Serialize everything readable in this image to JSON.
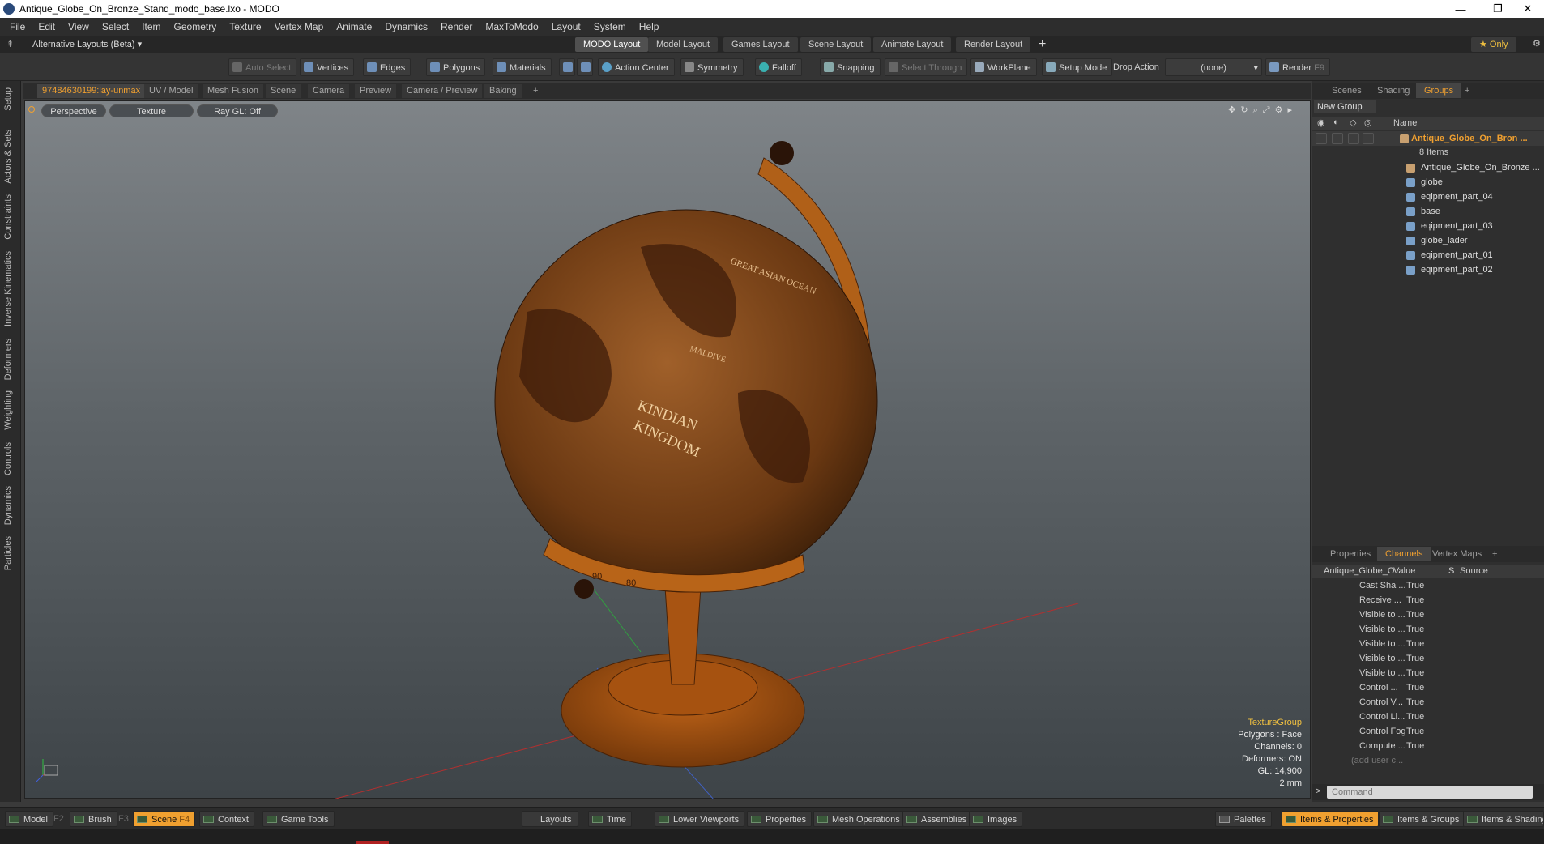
{
  "window": {
    "title": "Antique_Globe_On_Bronze_Stand_modo_base.lxo - MODO",
    "minimize": "—",
    "restore": "❐",
    "close": "✕"
  },
  "menu": [
    "File",
    "Edit",
    "View",
    "Select",
    "Item",
    "Geometry",
    "Texture",
    "Vertex Map",
    "Animate",
    "Dynamics",
    "Render",
    "MaxToModo",
    "Layout",
    "System",
    "Help"
  ],
  "layouts": {
    "current": "Alternative Layouts (Beta)",
    "tabs": [
      "MODO Layout",
      "Model Layout",
      "Games Layout",
      "Scene Layout",
      "Animate Layout",
      "Render Layout"
    ],
    "add": "+",
    "only": "★  Only"
  },
  "toolbar": {
    "auto_select": "Auto Select",
    "vertices": "Vertices",
    "edges": "Edges",
    "polygons": "Polygons",
    "materials": "Materials",
    "action_center": "Action Center",
    "symmetry": "Symmetry",
    "falloff": "Falloff",
    "snapping": "Snapping",
    "select_through": "Select Through",
    "workplane": "WorkPlane",
    "setup_mode": "Setup Mode",
    "drop_action": "Drop Action",
    "drop_value": "(none)",
    "render": "Render",
    "render_key": "F9"
  },
  "left_tabs": [
    "Setup",
    "Actors & Sets",
    "Constraints",
    "Inverse Kinematics",
    "Deformers",
    "Weighting",
    "Controls",
    "Dynamics",
    "Particles"
  ],
  "viewport_tabs": [
    "97484630199:lay-unmax",
    "UV / Model",
    "Mesh Fusion",
    "Scene",
    "Camera",
    "Preview",
    "Camera / Preview",
    "Baking",
    "+"
  ],
  "viewport": {
    "view": "Perspective",
    "shading": "Texture",
    "raygl": "Ray GL: Off",
    "globe_labels": [
      "GREAT ASIAN OCEAN",
      "KINDIAN",
      "KINGDOM",
      "MALDIVE"
    ],
    "stand_numbers": [
      "90",
      "80"
    ]
  },
  "vp_info": {
    "group": "TextureGroup",
    "polygons": "Polygons : Face",
    "channels": "Channels: 0",
    "deformers": "Deformers: ON",
    "gl": "GL: 14,900",
    "scale": "2 mm"
  },
  "scene_tabs": [
    "Scenes",
    "Shading",
    "Groups",
    "+"
  ],
  "groups": {
    "new_group": "New Group",
    "name_header": "Name",
    "root": "Antique_Globe_On_Bron ...",
    "count": "8 Items",
    "items": [
      "Antique_Globe_On_Bronze ...",
      "globe",
      "eqipment_part_04",
      "base",
      "eqipment_part_03",
      "globe_lader",
      "eqipment_part_01",
      "eqipment_part_02"
    ]
  },
  "prop_tabs": [
    "Properties",
    "Channels",
    "Vertex Maps",
    "+"
  ],
  "channels": {
    "headers": [
      "Antique_Globe_O ...",
      "Value",
      "S",
      "Source"
    ],
    "rows": [
      [
        "Cast Sha ...",
        "True"
      ],
      [
        "Receive ...",
        "True"
      ],
      [
        "Visible to ...",
        "True"
      ],
      [
        "Visible to ...",
        "True"
      ],
      [
        "Visible to ...",
        "True"
      ],
      [
        "Visible to ...",
        "True"
      ],
      [
        "Visible to ...",
        "True"
      ],
      [
        "Control ...",
        "True"
      ],
      [
        "Control V...",
        "True"
      ],
      [
        "Control Li...",
        "True"
      ],
      [
        "Control Fog",
        "True"
      ],
      [
        "Compute ...",
        "True"
      ]
    ],
    "add": "(add user c..."
  },
  "command": {
    "placeholder": "Command",
    "prompt": ">"
  },
  "bottom": {
    "model": "Model",
    "f2": "F2",
    "brush": "Brush",
    "f3": "F3",
    "scene": "Scene",
    "f4": "F4",
    "context": "Context",
    "game_tools": "Game Tools",
    "layouts": "Layouts",
    "time": "Time",
    "lower_viewports": "Lower Viewports",
    "properties": "Properties",
    "mesh_operations": "Mesh Operations",
    "assemblies": "Assemblies",
    "images": "Images",
    "palettes": "Palettes",
    "items_properties": "Items & Properties",
    "items_groups": "Items & Groups",
    "items_shading": "Items & Shading"
  },
  "colors": {
    "accent": "#f0a030",
    "globe": "#8a4a1c"
  }
}
